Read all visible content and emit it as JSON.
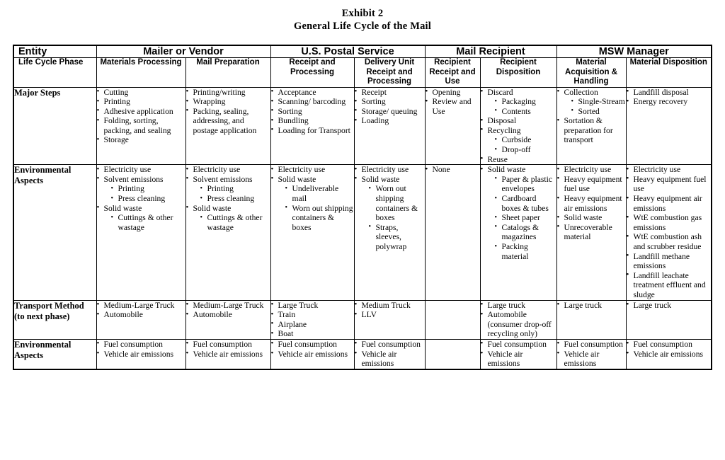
{
  "title": {
    "line1": "Exhibit 2",
    "line2": "General Life Cycle of the Mail"
  },
  "table": {
    "entity_header_label": "Entity",
    "phase_header_label": "Life Cycle Phase",
    "entities": [
      {
        "label": "Mailer or Vendor",
        "span": 2
      },
      {
        "label": "U.S. Postal Service",
        "span": 2
      },
      {
        "label": "Mail Recipient",
        "span": 2
      },
      {
        "label": "MSW Manager",
        "span": 2
      }
    ],
    "phases": [
      "Materials Processing",
      "Mail Preparation",
      "Receipt and Processing",
      "Delivery Unit Receipt and Processing",
      "Recipient Receipt and Use",
      "Recipient Disposition",
      "Material Acquisition & Handling",
      "Material Disposition"
    ],
    "rows": [
      {
        "label": "Major Steps",
        "cells": [
          [
            {
              "text": "Cutting"
            },
            {
              "text": "Printing"
            },
            {
              "text": "Adhesive application"
            },
            {
              "text": "Folding, sorting, packing, and sealing"
            },
            {
              "text": "Storage"
            }
          ],
          [
            {
              "text": "Printing/writing"
            },
            {
              "text": "Wrapping"
            },
            {
              "text": "Packing, sealing, addressing, and postage application"
            }
          ],
          [
            {
              "text": "Acceptance"
            },
            {
              "text": "Scanning/ barcoding"
            },
            {
              "text": "Sorting"
            },
            {
              "text": "Bundling"
            },
            {
              "text": "Loading for Transport"
            }
          ],
          [
            {
              "text": "Receipt"
            },
            {
              "text": "Sorting"
            },
            {
              "text": "Storage/ queuing"
            },
            {
              "text": "Loading"
            }
          ],
          [
            {
              "text": "Opening"
            },
            {
              "text": "Review and Use"
            }
          ],
          [
            {
              "text": "Discard",
              "sub": [
                "Packaging",
                "Contents"
              ]
            },
            {
              "text": "Disposal"
            },
            {
              "text": "Recycling",
              "sub": [
                "Curbside",
                "Drop-off"
              ]
            },
            {
              "text": "Reuse"
            }
          ],
          [
            {
              "text": "Collection",
              "sub": [
                "Single-Stream",
                "Sorted"
              ]
            },
            {
              "text": "Sortation & preparation for transport"
            }
          ],
          [
            {
              "text": "Landfill disposal"
            },
            {
              "text": "Energy recovery"
            }
          ]
        ]
      },
      {
        "label": "Environmental Aspects",
        "cells": [
          [
            {
              "text": "Electricity use"
            },
            {
              "text": "Solvent emissions",
              "sub": [
                "Printing",
                "Press cleaning"
              ]
            },
            {
              "text": "Solid waste",
              "sub": [
                "Cuttings & other wastage"
              ]
            }
          ],
          [
            {
              "text": "Electricity use"
            },
            {
              "text": "Solvent emissions",
              "sub": [
                "Printing",
                "Press cleaning"
              ]
            },
            {
              "text": "Solid waste",
              "sub": [
                "Cuttings & other wastage"
              ]
            }
          ],
          [
            {
              "text": "Electricity use"
            },
            {
              "text": "Solid waste",
              "sub": [
                "Undeliverable mail",
                "Worn out shipping containers & boxes"
              ]
            }
          ],
          [
            {
              "text": "Electricity use"
            },
            {
              "text": "Solid waste",
              "sub": [
                "Worn out shipping containers & boxes",
                "Straps, sleeves, polywrap"
              ]
            }
          ],
          [
            {
              "text": "None"
            }
          ],
          [
            {
              "text": "Solid waste",
              "sub": [
                "Paper & plastic envelopes",
                "Cardboard boxes & tubes",
                "Sheet paper",
                "Catalogs & magazines",
                "Packing material"
              ]
            }
          ],
          [
            {
              "text": "Electricity use"
            },
            {
              "text": "Heavy equipment fuel use"
            },
            {
              "text": "Heavy equipment air emissions"
            },
            {
              "text": "Solid waste"
            },
            {
              "text": "Unrecoverable material"
            }
          ],
          [
            {
              "text": "Electricity use"
            },
            {
              "text": "Heavy equipment fuel use"
            },
            {
              "text": "Heavy equipment air emissions"
            },
            {
              "text": "WtE combustion gas emissions"
            },
            {
              "text": "WtE combustion ash and scrubber residue"
            },
            {
              "text": "Landfill methane emissions"
            },
            {
              "text": "Landfill leachate treatment effluent and sludge"
            }
          ]
        ]
      },
      {
        "label": "Transport Method (to next phase)",
        "cells": [
          [
            {
              "text": "Medium-Large Truck"
            },
            {
              "text": "Automobile"
            }
          ],
          [
            {
              "text": "Medium-Large Truck"
            },
            {
              "text": "Automobile"
            }
          ],
          [
            {
              "text": "Large Truck"
            },
            {
              "text": "Train"
            },
            {
              "text": "Airplane"
            },
            {
              "text": "Boat"
            }
          ],
          [
            {
              "text": "Medium Truck"
            },
            {
              "text": "LLV"
            }
          ],
          [],
          [
            {
              "text": "Large truck"
            },
            {
              "text": "Automobile (consumer drop-off recycling only)"
            }
          ],
          [
            {
              "text": "Large truck"
            }
          ],
          [
            {
              "text": "Large truck"
            }
          ]
        ]
      },
      {
        "label": "Environmental Aspects",
        "cells": [
          [
            {
              "text": "Fuel consumption"
            },
            {
              "text": "Vehicle air emissions"
            }
          ],
          [
            {
              "text": "Fuel consumption"
            },
            {
              "text": "Vehicle air emissions"
            }
          ],
          [
            {
              "text": "Fuel consumption"
            },
            {
              "text": "Vehicle air emissions"
            }
          ],
          [
            {
              "text": "Fuel consumption"
            },
            {
              "text": "Vehicle air emissions"
            }
          ],
          [],
          [
            {
              "text": "Fuel consumption"
            },
            {
              "text": "Vehicle air emissions"
            }
          ],
          [
            {
              "text": "Fuel consumption"
            },
            {
              "text": "Vehicle air emissions"
            }
          ],
          [
            {
              "text": "Fuel consumption"
            },
            {
              "text": "Vehicle air emissions"
            }
          ]
        ]
      }
    ]
  }
}
